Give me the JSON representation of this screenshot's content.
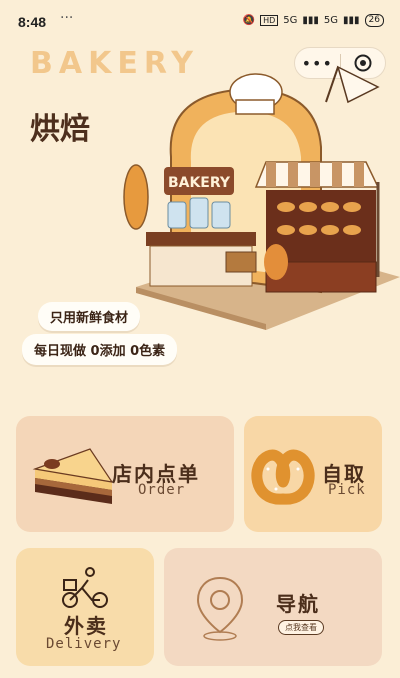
{
  "status": {
    "time": "8:48",
    "dots": "···",
    "hd": "HD",
    "net1": "5G",
    "net2": "5G",
    "battery": "26"
  },
  "header": {
    "brand": "BAKERY",
    "title": "烘焙"
  },
  "illustration": {
    "sign": "BAKERY"
  },
  "badges": {
    "fresh": "只用新鲜食材",
    "daily": "每日现做 0添加 0色素"
  },
  "menu": {
    "dine_in": {
      "title": "店内点单",
      "subtitle": "Order"
    },
    "pickup": {
      "title": "自取",
      "subtitle": "Pick"
    },
    "delivery": {
      "title": "外卖",
      "subtitle": "Delivery"
    },
    "navigation": {
      "title": "导航",
      "button": "点我查看"
    }
  },
  "colors": {
    "background": "#fbeed6",
    "accent": "#f2c78c",
    "text": "#4b2e1b"
  },
  "icons": [
    "more-icon",
    "close-target-icon",
    "cake-icon",
    "pretzel-icon",
    "delivery-rider-icon",
    "map-pin-icon"
  ]
}
